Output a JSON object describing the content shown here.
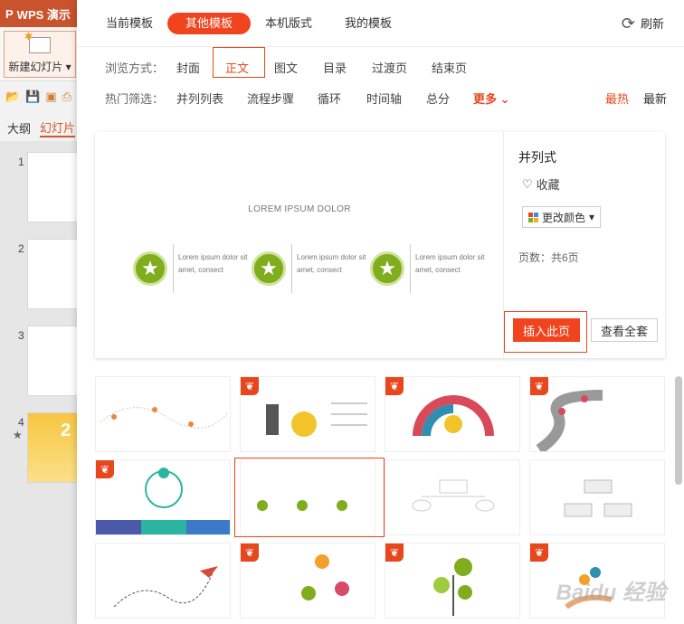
{
  "app": {
    "title": "WPS 演示",
    "new_slide_label": "新建幻灯片",
    "tabs": [
      "大纲",
      "幻灯片"
    ],
    "slide_numbers": [
      "1",
      "2",
      "3",
      "4"
    ],
    "thumb4_text": "2"
  },
  "topnav": {
    "tabs": [
      "当前模板",
      "其他模板",
      "本机版式",
      "我的模板"
    ],
    "active_index": 1,
    "refresh_label": "刷新"
  },
  "browse": {
    "label": "浏览方式：",
    "items": [
      "封面",
      "正文",
      "图文",
      "目录",
      "过渡页",
      "结束页"
    ],
    "selected_index": 1
  },
  "hot": {
    "label": "热门筛选：",
    "items": [
      "并列列表",
      "流程步骤",
      "循环",
      "时间轴",
      "总分"
    ],
    "more_label": "更多",
    "sort": [
      "最热",
      "最新"
    ],
    "sort_active_index": 0
  },
  "preview": {
    "slide_title": "LOREM IPSUM DOLOR",
    "items": [
      {
        "text": "Lorem ipsum dolor sit amet, consect"
      },
      {
        "text": "Lorem ipsum dolor sit amet, consect"
      },
      {
        "text": "Lorem ipsum dolor sit amet, consect"
      }
    ],
    "template_name": "并列式",
    "favorite_label": "收藏",
    "change_color_label": "更改颜色",
    "page_count": "页数：共6页",
    "insert_label": "插入此页",
    "view_all_label": "查看全套"
  },
  "colors": {
    "accent": "#f0441e",
    "green": "#7fad1e"
  },
  "watermark": "Baidu 经验"
}
